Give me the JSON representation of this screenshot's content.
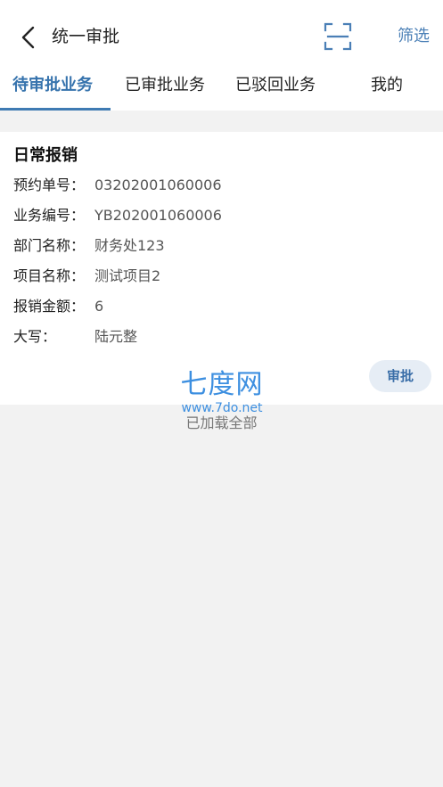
{
  "header": {
    "title": "统一审批",
    "filter_label": "筛选"
  },
  "icons": {
    "back": "back-arrow-icon",
    "scan": "scan-icon"
  },
  "tabs": [
    {
      "label": "待审批业务",
      "active": true
    },
    {
      "label": "已审批业务",
      "active": false
    },
    {
      "label": "已驳回业务",
      "active": false
    },
    {
      "label": "我的",
      "active": false
    }
  ],
  "card": {
    "title": "日常报销",
    "rows": [
      {
        "label": "预约单号：",
        "value": "03202001060006"
      },
      {
        "label": "业务编号：",
        "value": "YB202001060006"
      },
      {
        "label": "部门名称：",
        "value": "财务处123"
      },
      {
        "label": "项目名称：",
        "value": "测试项目2"
      },
      {
        "label": "报销金额：",
        "value": "6"
      },
      {
        "label": "大写：",
        "value": "陆元整"
      }
    ],
    "approve_label": "审批"
  },
  "watermark": {
    "main": "七度网",
    "url": "www.7do.net"
  },
  "footer": {
    "loaded_all": "已加载全部"
  },
  "colors": {
    "accent": "#3673ad",
    "filter": "#4a7fb6",
    "approve_bg": "#e6edf5",
    "background": "#f2f2f2"
  }
}
